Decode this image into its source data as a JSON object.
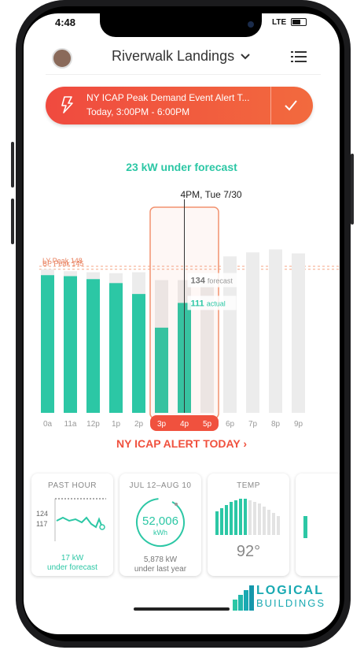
{
  "status": {
    "time": "4:48",
    "network": "LTE"
  },
  "header": {
    "site_name": "Riverwalk Landings"
  },
  "alert": {
    "title": "NY ICAP Peak Demand Event Alert T...",
    "time": "Today, 3:00PM - 6:00PM"
  },
  "headline": "23 kW under forecast",
  "chart_data": {
    "type": "bar",
    "categories": [
      "0a",
      "11a",
      "12p",
      "1p",
      "2p",
      "3p",
      "4p",
      "5p",
      "6p",
      "7p",
      "8p",
      "9p"
    ],
    "series": [
      {
        "name": "forecast",
        "values": [
          145,
          143,
          142,
          141,
          142,
          134,
          134,
          134,
          158,
          162,
          165,
          161
        ]
      },
      {
        "name": "actual",
        "values": [
          139,
          138,
          135,
          131,
          120,
          86,
          111,
          null,
          null,
          null,
          null,
          null
        ]
      }
    ],
    "reference_lines": [
      {
        "label": "LY Peak 148",
        "value": 148
      },
      {
        "label": "BP Peak 145",
        "value": 145
      }
    ],
    "selected": {
      "label": "4PM, Tue 7/30",
      "forecast": 134,
      "forecast_label": "forecast",
      "actual": 111,
      "actual_label": "actual"
    },
    "alert_categories": [
      "3p",
      "4p",
      "5p"
    ],
    "ylim": [
      0,
      175
    ]
  },
  "alert_today": "NY ICAP ALERT TODAY ›",
  "cards": {
    "past_hour": {
      "title": "PAST HOUR",
      "y_top": "124",
      "y_bottom": "117",
      "value": "17 kW",
      "sub": "under forecast"
    },
    "period": {
      "title": "JUL 12–AUG 10",
      "value": "52,006",
      "unit": "kWh",
      "diff": "5,878 kW",
      "sub": "under last year"
    },
    "temp": {
      "title": "TEMP",
      "value": "92°"
    }
  },
  "logo": {
    "line1": "LOGICAL",
    "line2": "BUILDINGS"
  },
  "colors": {
    "accent": "#2cc7a5",
    "alert": "#f0513e",
    "bar_bg": "#ececec"
  }
}
